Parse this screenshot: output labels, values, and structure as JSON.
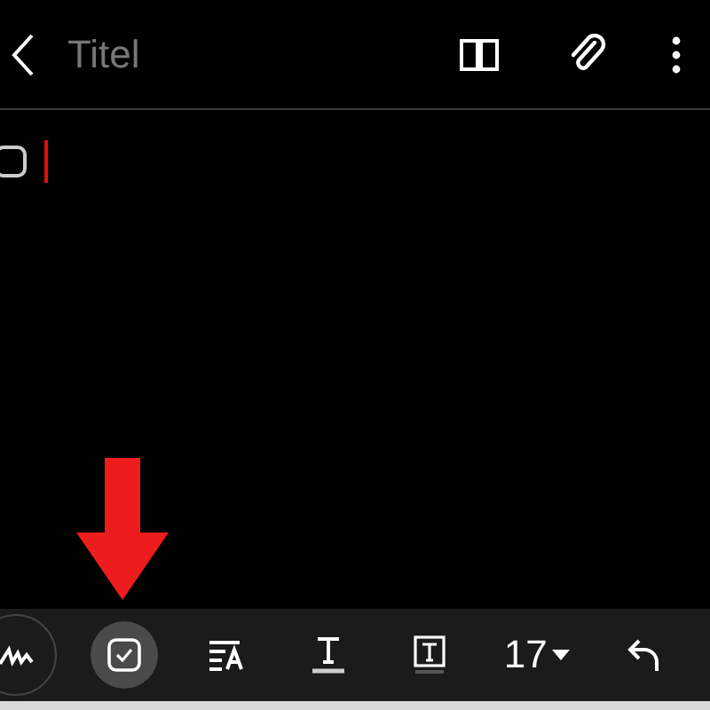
{
  "header": {
    "title_placeholder": "Titel"
  },
  "body": {
    "checklist": [
      {
        "checked": false
      }
    ]
  },
  "toolbar": [
    {
      "kind": "handwriting",
      "selected": false
    },
    {
      "kind": "checklist",
      "selected": true
    },
    {
      "kind": "text-style",
      "selected": false
    },
    {
      "kind": "text-color",
      "selected": false
    },
    {
      "kind": "text-background",
      "selected": false
    },
    {
      "kind": "font-size",
      "selected": false,
      "label": "17"
    },
    {
      "kind": "undo",
      "selected": false
    }
  ]
}
